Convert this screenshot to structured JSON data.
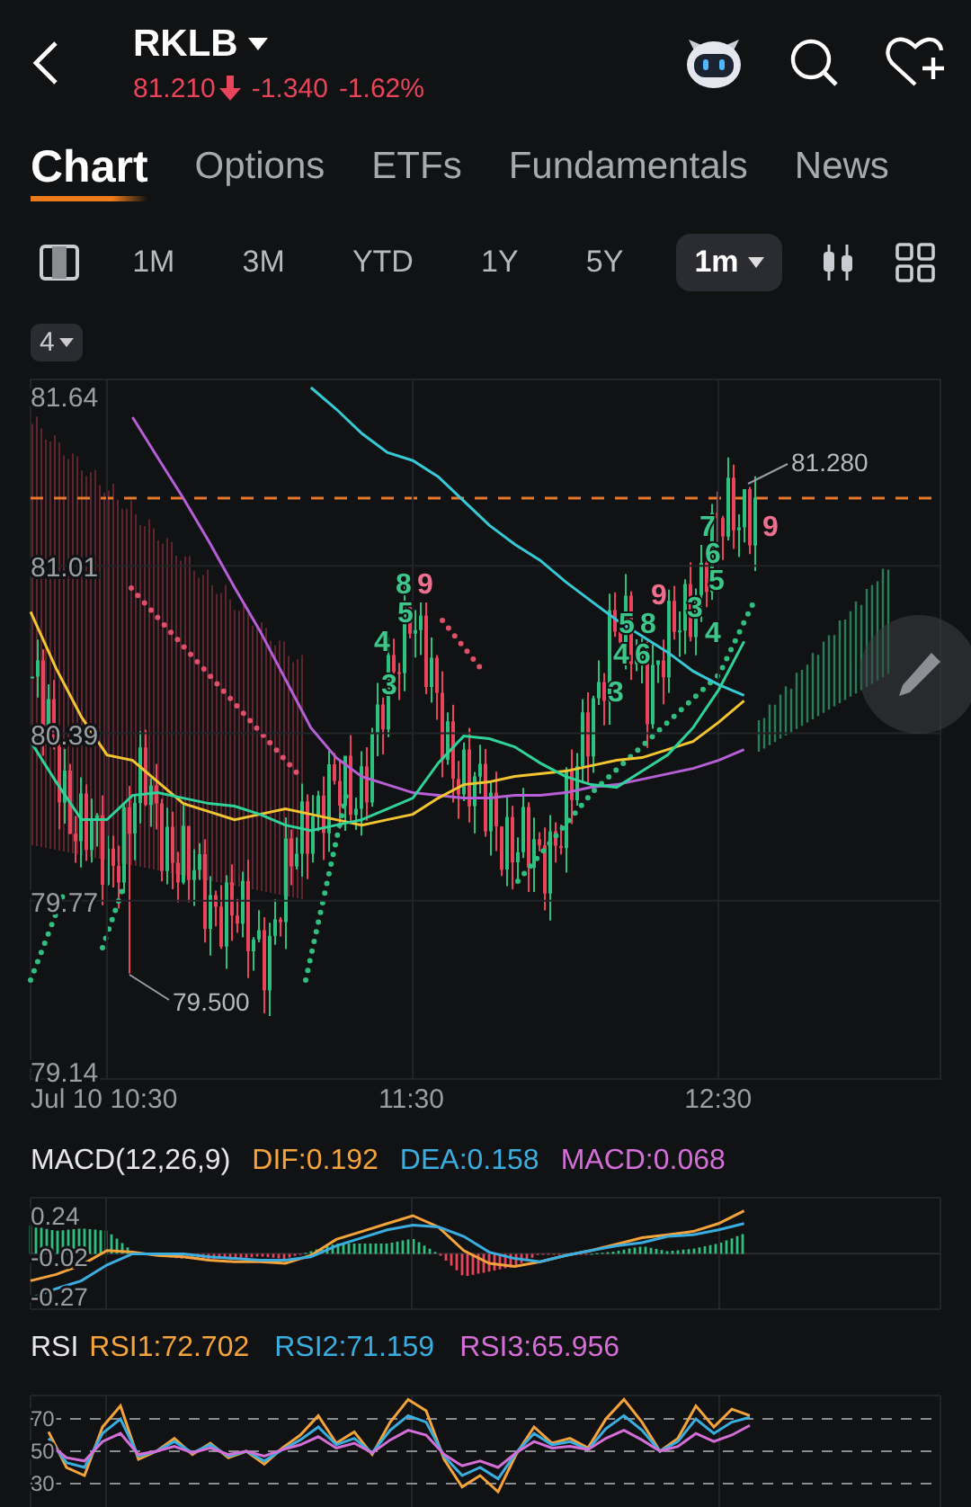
{
  "header": {
    "symbol": "RKLB",
    "price": "81.210",
    "change": "-1.340",
    "change_percent": "-1.62%"
  },
  "tabs": [
    {
      "label": "Chart",
      "selected": true
    },
    {
      "label": "Options",
      "selected": false
    },
    {
      "label": "ETFs",
      "selected": false
    },
    {
      "label": "Fundamentals",
      "selected": false
    },
    {
      "label": "News",
      "selected": false
    }
  ],
  "periods": [
    {
      "label": "1M",
      "selected": false,
      "dropdown": false
    },
    {
      "label": "3M",
      "selected": false,
      "dropdown": false
    },
    {
      "label": "YTD",
      "selected": false,
      "dropdown": false
    },
    {
      "label": "1Y",
      "selected": false,
      "dropdown": false
    },
    {
      "label": "5Y",
      "selected": false,
      "dropdown": false
    },
    {
      "label": "1m",
      "selected": true,
      "dropdown": true
    }
  ],
  "indicator_count": "4",
  "price_chart": {
    "chart_data": {
      "type": "line",
      "grid": true,
      "categories": [
        null,
        null,
        null,
        "Jul 10 10:30",
        null,
        null,
        null,
        null,
        null,
        null,
        null,
        null,
        null,
        null,
        null,
        "11:30",
        null,
        null,
        null,
        null,
        null,
        null,
        null,
        null,
        null,
        null,
        null,
        "12:30",
        null
      ],
      "ylim": [
        79.11,
        81.7
      ],
      "yticks": [
        81.64,
        81.01,
        80.39,
        79.77,
        79.14
      ],
      "series": [
        {
          "color": "#b65fd6",
          "values": [
            null,
            null,
            null,
            null,
            81.56,
            81.41,
            81.26,
            81.1,
            80.93,
            80.77,
            80.59,
            80.41,
            80.3,
            80.23,
            80.2,
            80.17,
            80.16,
            80.15,
            80.15,
            80.16,
            80.16,
            80.17,
            80.19,
            80.2,
            80.22,
            80.24,
            80.26,
            80.29,
            80.33
          ]
        },
        {
          "color": "#36c9d6",
          "values": [
            null,
            null,
            null,
            null,
            null,
            null,
            null,
            null,
            null,
            null,
            null,
            81.67,
            81.59,
            81.5,
            81.43,
            81.4,
            81.34,
            81.25,
            81.16,
            81.09,
            81.03,
            80.95,
            80.88,
            80.81,
            80.75,
            80.69,
            80.62,
            80.57,
            80.53
          ]
        },
        {
          "color": "#f3c530",
          "values": [
            80.84,
            80.63,
            80.45,
            80.31,
            80.29,
            80.21,
            80.13,
            80.1,
            80.07,
            80.09,
            80.11,
            80.09,
            80.07,
            80.05,
            80.07,
            80.09,
            80.15,
            80.2,
            80.21,
            80.23,
            80.24,
            80.25,
            80.27,
            80.29,
            80.3,
            80.33,
            80.36,
            80.43,
            80.51
          ]
        },
        {
          "color": "#2fd39a",
          "values": [
            80.36,
            80.21,
            80.07,
            80.07,
            80.16,
            80.17,
            80.15,
            80.13,
            80.12,
            80.09,
            80.05,
            80.03,
            80.05,
            80.07,
            80.11,
            80.15,
            80.28,
            80.38,
            80.37,
            80.34,
            80.28,
            80.23,
            80.2,
            80.19,
            80.25,
            80.31,
            80.41,
            80.55,
            80.73
          ]
        }
      ]
    },
    "high_label": "81.280",
    "low_label": "79.500",
    "td_marks": [
      {
        "text": "8",
        "color": "#3cc68a"
      },
      {
        "text": "9",
        "color": "#ef6f8e"
      },
      {
        "text": "5",
        "color": "#3cc68a"
      },
      {
        "text": "4",
        "color": "#3cc68a"
      },
      {
        "text": "3",
        "color": "#3cc68a"
      },
      {
        "text": "9",
        "color": "#ef6f8e"
      },
      {
        "text": "5",
        "color": "#3cc68a"
      },
      {
        "text": "8",
        "color": "#3cc68a"
      },
      {
        "text": "4",
        "color": "#3cc68a"
      },
      {
        "text": "6",
        "color": "#3cc68a"
      },
      {
        "text": "3",
        "color": "#3cc68a"
      },
      {
        "text": "7",
        "color": "#3cc68a"
      },
      {
        "text": "9",
        "color": "#ef6f8e"
      },
      {
        "text": "6",
        "color": "#3cc68a"
      },
      {
        "text": "5",
        "color": "#3cc68a"
      },
      {
        "text": "3",
        "color": "#3cc68a"
      },
      {
        "text": "4",
        "color": "#3cc68a"
      }
    ]
  },
  "macd": {
    "title": "MACD(12,26,9)",
    "values": [
      {
        "label": "DIF:0.192",
        "color": "#f5a33b"
      },
      {
        "label": "DEA:0.158",
        "color": "#3aaee0"
      },
      {
        "label": "MACD:0.068",
        "color": "#d56fd8"
      }
    ],
    "chart_data": {
      "type": "line",
      "grid": true,
      "ylim": [
        -0.349,
        0.353
      ],
      "yticks": [
        0.24,
        -0.02,
        -0.27
      ],
      "series": [
        {
          "color": "#f5a33b",
          "values": [
            -0.17,
            -0.13,
            -0.07,
            0.02,
            0.01,
            -0.01,
            -0.02,
            -0.04,
            -0.05,
            -0.05,
            -0.06,
            -0.01,
            0.09,
            0.14,
            0.19,
            0.24,
            0.17,
            0.02,
            -0.06,
            -0.08,
            -0.05,
            -0.01,
            0.02,
            0.06,
            0.1,
            0.12,
            0.14,
            0.19,
            0.27
          ]
        },
        {
          "color": "#3aaee0",
          "values": [
            -0.28,
            -0.22,
            -0.17,
            -0.07,
            0,
            0,
            0,
            -0.02,
            -0.03,
            -0.04,
            -0.04,
            -0.02,
            0.05,
            0.1,
            0.15,
            0.18,
            0.17,
            0.11,
            0.01,
            -0.03,
            -0.05,
            -0.01,
            0.02,
            0.05,
            0.07,
            0.11,
            0.12,
            0.15,
            0.19
          ]
        }
      ]
    }
  },
  "rsi": {
    "title": "RSI",
    "values": [
      {
        "label": "RSI1:72.702",
        "color": "#f5a33b"
      },
      {
        "label": "RSI2:71.159",
        "color": "#3aaee0"
      },
      {
        "label": "RSI3:65.956",
        "color": "#d56fd8"
      }
    ],
    "chart_data": {
      "type": "line",
      "grid": true,
      "ylim": [
        15.6,
        84.4
      ],
      "yticks": [
        70,
        50,
        30
      ],
      "series": [
        {
          "color": "#f5a33b",
          "values": [
            null,
            62,
            40,
            35,
            65,
            78,
            45,
            50,
            58,
            48,
            55,
            46,
            50,
            42,
            52,
            60,
            72,
            55,
            62,
            48,
            68,
            82,
            75,
            45,
            28,
            35,
            25,
            48,
            65,
            55,
            58,
            52,
            70,
            82,
            68,
            50,
            58,
            78,
            65,
            76,
            72
          ]
        },
        {
          "color": "#3aaee0",
          "values": [
            null,
            58,
            43,
            40,
            61,
            70,
            47,
            50,
            56,
            49,
            54,
            47,
            50,
            44,
            51,
            57,
            65,
            54,
            58,
            49,
            63,
            72,
            68,
            47,
            35,
            40,
            33,
            49,
            61,
            54,
            56,
            51,
            64,
            72,
            63,
            50,
            56,
            70,
            61,
            68,
            71
          ]
        },
        {
          "color": "#d56fd8",
          "values": [
            null,
            55,
            46,
            44,
            56,
            61,
            48,
            50,
            53,
            49,
            52,
            48,
            50,
            47,
            51,
            54,
            59,
            52,
            55,
            49,
            57,
            63,
            60,
            48,
            41,
            44,
            40,
            49,
            56,
            52,
            53,
            51,
            58,
            63,
            57,
            50,
            53,
            61,
            56,
            60,
            66
          ]
        }
      ]
    }
  }
}
